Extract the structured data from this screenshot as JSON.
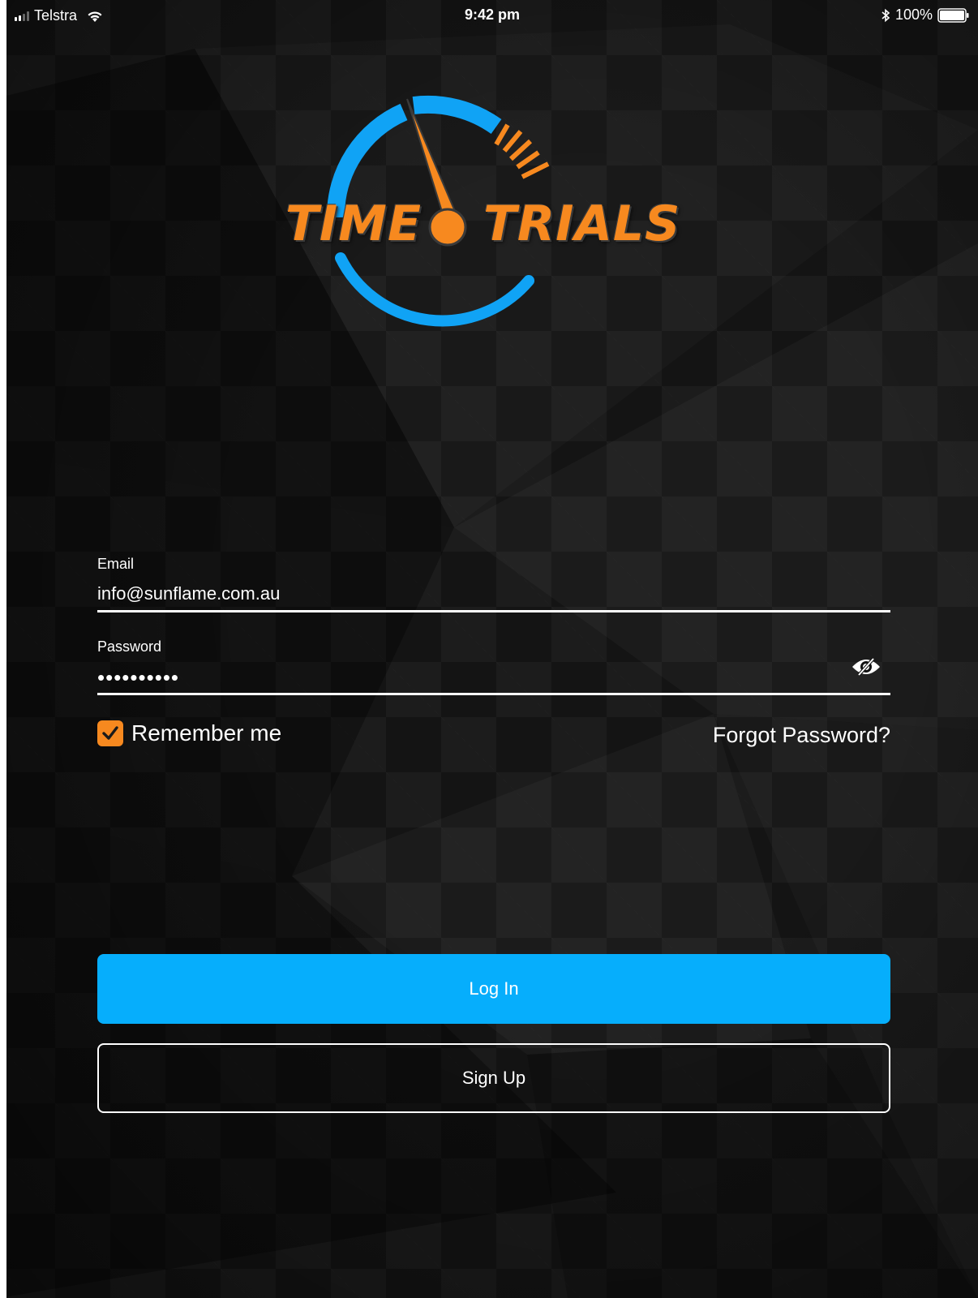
{
  "status_bar": {
    "carrier": "Telstra",
    "time": "9:42 pm",
    "battery": "100%",
    "signal_icon": "signal-bars-icon",
    "wifi_icon": "wifi-icon",
    "bluetooth_icon": "bluetooth-icon",
    "battery_icon": "battery-icon"
  },
  "logo": {
    "word_left": "TIME",
    "word_right": "TRIALS",
    "colors": {
      "orange": "#f7891f",
      "blue": "#10a3f5"
    }
  },
  "form": {
    "email": {
      "label": "Email",
      "value": "info@sunflame.com.au"
    },
    "password": {
      "label": "Password",
      "value": "••••••••••",
      "reveal_icon": "eye-slash-icon"
    },
    "remember_me": {
      "label": "Remember me",
      "checked": true,
      "icon": "checkmark-icon"
    },
    "forgot_password": "Forgot Password?"
  },
  "actions": {
    "login": "Log In",
    "signup": "Sign Up"
  },
  "colors": {
    "accent_blue": "#06aefc",
    "accent_orange": "#f7891f",
    "background": "#121212"
  }
}
